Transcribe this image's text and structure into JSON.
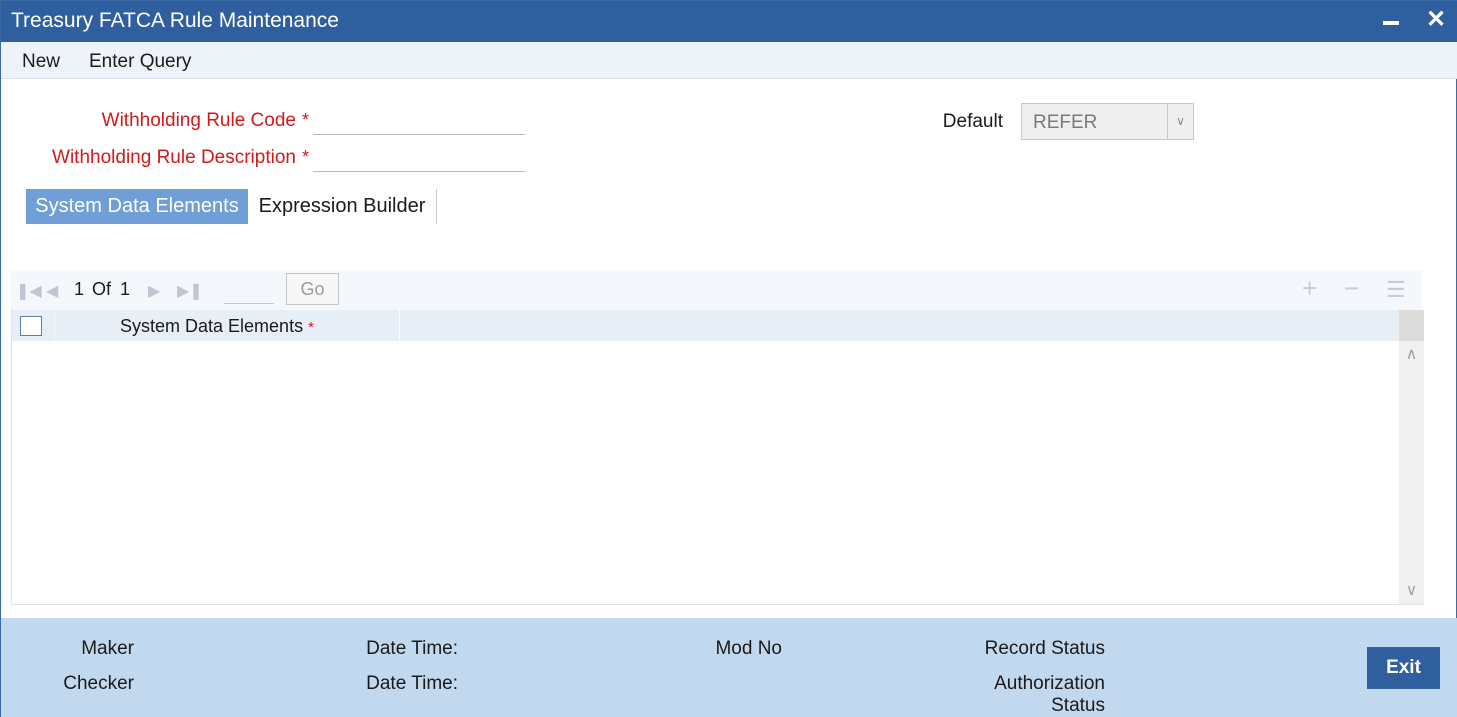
{
  "window": {
    "title": "Treasury FATCA Rule Maintenance",
    "close_glyph": "✕"
  },
  "menu": {
    "items": [
      {
        "label": "New"
      },
      {
        "label": "Enter Query"
      }
    ]
  },
  "form": {
    "rule_code_label": "Withholding Rule Code",
    "rule_code_value": "",
    "rule_description_label": "Withholding Rule Description",
    "rule_description_value": "",
    "required_marker": "*",
    "default_label": "Default",
    "default_value": "REFER",
    "default_options": [
      "REFER"
    ]
  },
  "tabs": [
    {
      "label": "System Data Elements",
      "active": true
    },
    {
      "label": "Expression Builder",
      "active": false
    }
  ],
  "grid": {
    "pager": {
      "current": "1",
      "of_label": "Of",
      "total": "1",
      "go_label": "Go"
    },
    "columns": [
      {
        "label": "System Data Elements",
        "required_marker": "*"
      }
    ],
    "rows": []
  },
  "footer": {
    "maker_label": "Maker",
    "checker_label": "Checker",
    "date_time_label_1": "Date Time:",
    "date_time_label_2": "Date Time:",
    "mod_no_label": "Mod No",
    "record_status_label": "Record Status",
    "authorization_label": "Authorization",
    "status_label": "Status",
    "exit_label": "Exit"
  },
  "colors": {
    "titlebar": "#2f5f9f",
    "active_tab": "#6f9fd6",
    "required": "#d01a1a",
    "footer": "#c2d8ee"
  }
}
